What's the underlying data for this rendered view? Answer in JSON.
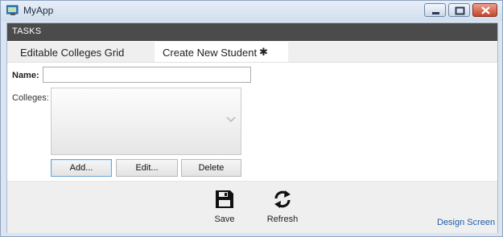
{
  "window": {
    "title": "MyApp"
  },
  "tasks": {
    "label": "TASKS"
  },
  "tabs": [
    {
      "label": "Editable Colleges Grid"
    },
    {
      "label": "Create New Student",
      "modified_marker": "✱"
    }
  ],
  "form": {
    "name_label": "Name:",
    "name_value": "",
    "colleges_label": "Colleges:"
  },
  "list_buttons": {
    "add": "Add...",
    "edit": "Edit...",
    "delete": "Delete"
  },
  "commands": {
    "save": "Save",
    "refresh": "Refresh"
  },
  "design_link": "Design Screen"
}
